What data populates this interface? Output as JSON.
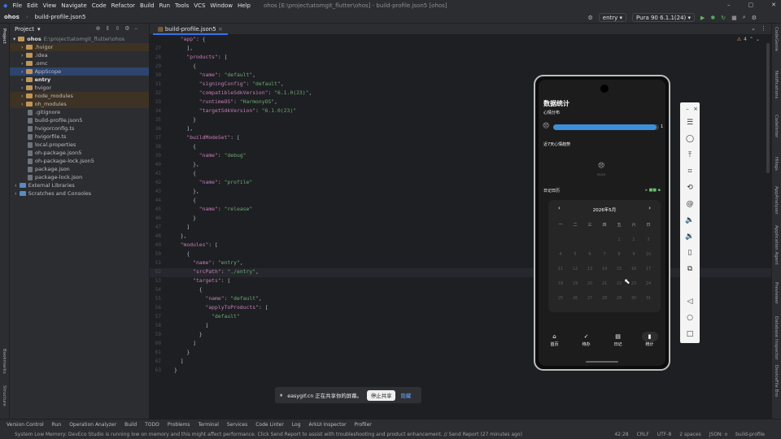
{
  "menubar": {
    "items": [
      "File",
      "Edit",
      "View",
      "Navigate",
      "Code",
      "Refactor",
      "Build",
      "Run",
      "Tools",
      "VCS",
      "Window",
      "Help"
    ],
    "caption": "ohos [E:\\project\\atomgit_flutter\\ohos] - build-profile.json5 [ohos]"
  },
  "toolbar": {
    "breadcrumb_root": "ohos",
    "breadcrumb_file": "build-profile.json5",
    "run_config": "entry",
    "device": "Pura 90 6.1.1(24)"
  },
  "project": {
    "title": "Project",
    "root_label": "ohos",
    "root_path": "E:\\project\\atomgit_flutter\\ohos",
    "items": [
      {
        "label": ".hvigor",
        "kind": "dir",
        "depth": 1
      },
      {
        "label": ".idea",
        "kind": "dir",
        "depth": 1
      },
      {
        "label": ".omc",
        "kind": "dir",
        "depth": 1
      },
      {
        "label": "AppScope",
        "kind": "dir",
        "depth": 1
      },
      {
        "label": "entry",
        "kind": "dir",
        "depth": 1
      },
      {
        "label": "hvigor",
        "kind": "dir",
        "depth": 1
      },
      {
        "label": "node_modules",
        "kind": "dir",
        "depth": 1
      },
      {
        "label": "oh_modules",
        "kind": "dir",
        "depth": 1
      },
      {
        "label": ".gitignore",
        "kind": "file",
        "depth": 2
      },
      {
        "label": "build-profile.json5",
        "kind": "file",
        "depth": 2
      },
      {
        "label": "hvigorconfig.ts",
        "kind": "file",
        "depth": 2
      },
      {
        "label": "hvigorfile.ts",
        "kind": "file",
        "depth": 2
      },
      {
        "label": "local.properties",
        "kind": "file",
        "depth": 2
      },
      {
        "label": "oh-package.json5",
        "kind": "file",
        "depth": 2
      },
      {
        "label": "oh-package-lock.json5",
        "kind": "file",
        "depth": 2
      },
      {
        "label": "package.json",
        "kind": "file",
        "depth": 2
      },
      {
        "label": "package-lock.json",
        "kind": "file",
        "depth": 2
      },
      {
        "label": "External Libraries",
        "kind": "lib",
        "depth": 0
      },
      {
        "label": "Scratches and Consoles",
        "kind": "lib",
        "depth": 0
      }
    ]
  },
  "editor": {
    "tab": "build-profile.json5",
    "warnings": "4",
    "first_line": 26,
    "lines": [
      "  \"app\": {",
      "    ],",
      "    \"products\": [",
      "      {",
      "        \"name\": \"default\",",
      "        \"signingConfig\": \"default\",",
      "        \"compatibleSdkVersion\": \"6.1.0(23)\",",
      "        \"runtimeOS\": \"HarmonyOS\",",
      "        \"targetSdkVersion\": \"6.1.0(23)\"",
      "      }",
      "    ],",
      "    \"buildModeSet\": [",
      "      {",
      "        \"name\": \"debug\"",
      "      },",
      "      {",
      "        \"name\": \"profile\"",
      "      },",
      "      {",
      "        \"name\": \"release\"",
      "      }",
      "    ]",
      "  },",
      "  \"modules\": [",
      "    {",
      "      \"name\": \"entry\",",
      "      \"srcPath\": \"./entry\",",
      "      \"targets\": [",
      "        {",
      "          \"name\": \"default\",",
      "          \"applyToProducts\": [",
      "            \"default\"",
      "          ]",
      "        }",
      "      ]",
      "    }",
      "  ]",
      "}"
    ]
  },
  "phone": {
    "title": "数据统计",
    "mood_label": "心情分布",
    "mood_count": "1",
    "mood_fill": 0.98,
    "trend_label": "近7天心情趋势",
    "trend_date": "05/23",
    "diary_label": "日记日历",
    "calendar_month": "2026年5月",
    "weekdays": [
      "一",
      "二",
      "三",
      "四",
      "五",
      "六",
      "日"
    ],
    "weeks": [
      [
        "",
        "",
        "",
        "",
        "1",
        "2",
        "3"
      ],
      [
        "4",
        "5",
        "6",
        "7",
        "8",
        "9",
        "10"
      ],
      [
        "11",
        "12",
        "13",
        "14",
        "15",
        "16",
        "17"
      ],
      [
        "18",
        "19",
        "20",
        "21",
        "22",
        "23",
        "24"
      ],
      [
        "25",
        "26",
        "27",
        "28",
        "29",
        "30",
        "31"
      ]
    ],
    "nav": [
      "首页",
      "待办",
      "日记",
      "统计"
    ]
  },
  "right_strip": [
    "CodeGenie",
    "Notifications",
    "Codelinter",
    "Hilogs",
    "AppAnalyzer",
    "Application Agent",
    "Previewer",
    "Database Inspector",
    "DeviceFile Bro"
  ],
  "left_strip": [
    "Bookmarks",
    "Structure"
  ],
  "bottom_tools": [
    "Version Control",
    "Run",
    "Operation Analyzer",
    "Build",
    "TODO",
    "Problems",
    "Terminal",
    "Services",
    "Code Linter",
    "Log",
    "ArkUI Inspector",
    "Profiler"
  ],
  "status": {
    "message": "System Low Memory: DevEco Studio is running low on memory and this might affect performance. Click Send Report to assist with troubleshooting and product enhancement. // Send Report (27 minutes ago)",
    "position": "42:28",
    "line_sep": "CRLF",
    "encoding": "UTF-8",
    "indent": "2 spaces",
    "schema": "JSON: o",
    "file": "build-profile"
  },
  "share": {
    "text": "easygif.cn 正在共享你的屏幕。",
    "stop": "停止共享",
    "hide": "隐藏"
  }
}
